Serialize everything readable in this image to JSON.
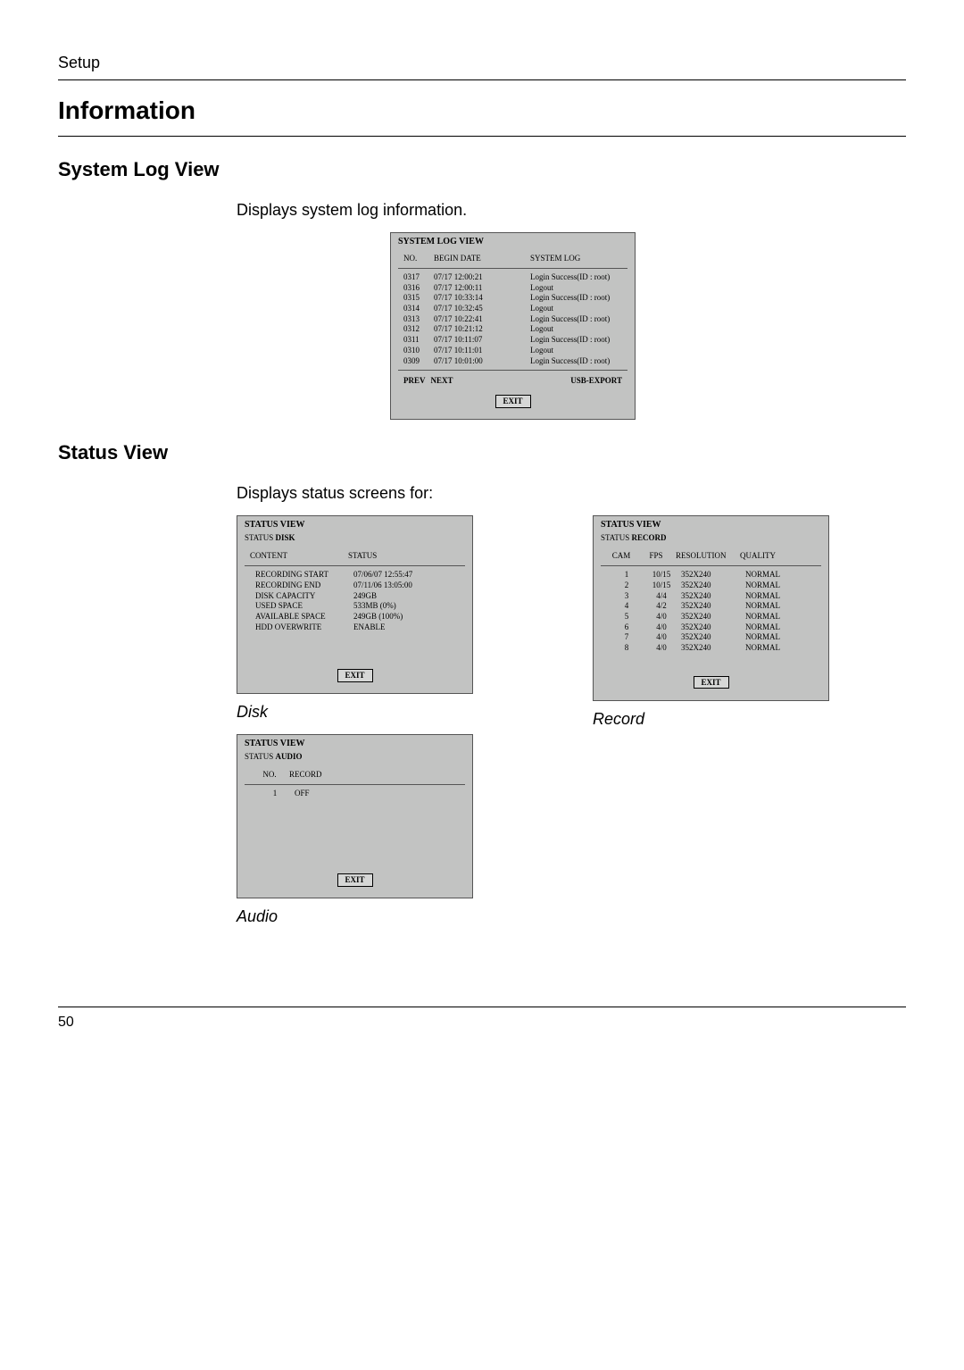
{
  "page_header": "Setup",
  "page_number": "50",
  "h1": "Information",
  "section_syslog": {
    "heading": "System Log View",
    "desc": "Displays system log information.",
    "panel_title": "SYSTEM LOG VIEW",
    "cols": {
      "no": "NO.",
      "date": "BEGIN DATE",
      "msg": "SYSTEM LOG"
    },
    "rows": [
      {
        "no": "0317",
        "date": "07/17 12:00:21",
        "msg": "Login Success(ID : root)"
      },
      {
        "no": "0316",
        "date": "07/17 12:00:11",
        "msg": "Logout"
      },
      {
        "no": "0315",
        "date": "07/17 10:33:14",
        "msg": "Login Success(ID : root)"
      },
      {
        "no": "0314",
        "date": "07/17 10:32:45",
        "msg": "Logout"
      },
      {
        "no": "0313",
        "date": "07/17 10:22:41",
        "msg": "Login Success(ID : root)"
      },
      {
        "no": "0312",
        "date": "07/17 10:21:12",
        "msg": "Logout"
      },
      {
        "no": "0311",
        "date": "07/17 10:11:07",
        "msg": "Login Success(ID : root)"
      },
      {
        "no": "0310",
        "date": "07/17 10:11:01",
        "msg": "Logout"
      },
      {
        "no": "0309",
        "date": "07/17 10:01:00",
        "msg": "Login Success(ID : root)"
      }
    ],
    "prev": "PREV",
    "next": "NEXT",
    "usb": "USB-EXPORT",
    "exit": "EXIT"
  },
  "section_status": {
    "heading": "Status View",
    "desc": "Displays status screens for:",
    "exit": "EXIT"
  },
  "disk": {
    "caption": "Disk",
    "title": "STATUS VIEW",
    "sub_label": "STATUS",
    "sub_value": "DISK",
    "cols": {
      "left": "CONTENT",
      "right": "STATUS"
    },
    "rows": [
      {
        "l": "RECORDING START",
        "r": "07/06/07  12:55:47"
      },
      {
        "l": "RECORDING END",
        "r": "07/11/06  13:05:00"
      },
      {
        "l": "DISK CAPACITY",
        "r": "249GB"
      },
      {
        "l": "USED SPACE",
        "r": "533MB  (0%)"
      },
      {
        "l": "AVAILABLE SPACE",
        "r": "249GB  (100%)"
      },
      {
        "l": "HDD OVERWRITE",
        "r": "ENABLE"
      }
    ]
  },
  "record": {
    "caption": "Record",
    "title": "STATUS VIEW",
    "sub_label": "STATUS",
    "sub_value": "RECORD",
    "cols": {
      "c1": "CAM",
      "c2": "FPS",
      "c3": "RESOLUTION",
      "c4": "QUALITY"
    },
    "rows": [
      {
        "c1": "1",
        "c2": "10/15",
        "c3": "352X240",
        "c4": "NORMAL"
      },
      {
        "c1": "2",
        "c2": "10/15",
        "c3": "352X240",
        "c4": "NORMAL"
      },
      {
        "c1": "3",
        "c2": "4/4",
        "c3": "352X240",
        "c4": "NORMAL"
      },
      {
        "c1": "4",
        "c2": "4/2",
        "c3": "352X240",
        "c4": "NORMAL"
      },
      {
        "c1": "5",
        "c2": "4/0",
        "c3": "352X240",
        "c4": "NORMAL"
      },
      {
        "c1": "6",
        "c2": "4/0",
        "c3": "352X240",
        "c4": "NORMAL"
      },
      {
        "c1": "7",
        "c2": "4/0",
        "c3": "352X240",
        "c4": "NORMAL"
      },
      {
        "c1": "8",
        "c2": "4/0",
        "c3": "352X240",
        "c4": "NORMAL"
      }
    ]
  },
  "audio": {
    "caption": "Audio",
    "title": "STATUS VIEW",
    "sub_label": "STATUS",
    "sub_value": "AUDIO",
    "cols": {
      "c1": "NO.",
      "c2": "RECORD"
    },
    "rows": [
      {
        "c1": "1",
        "c2": "OFF"
      }
    ]
  }
}
